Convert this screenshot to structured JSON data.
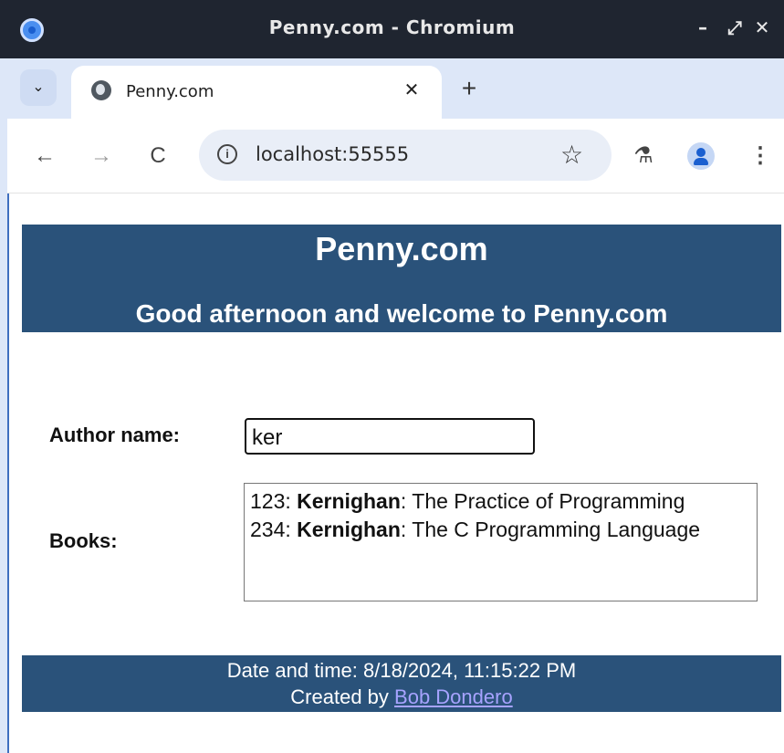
{
  "window": {
    "title": "Penny.com - Chromium",
    "minimize_glyph": "–",
    "maximize_glyph": "⤢",
    "close_glyph": "✕"
  },
  "tabs": {
    "dropdown_glyph": "⌄",
    "active": {
      "title": "Penny.com",
      "close_glyph": "✕"
    },
    "new_tab_glyph": "+"
  },
  "toolbar": {
    "back_glyph": "←",
    "forward_glyph": "→",
    "reload_glyph": "C",
    "info_glyph": "i",
    "url": "localhost:55555",
    "star_glyph": "☆",
    "labs_glyph": "⚗",
    "menu_glyph": "⋮"
  },
  "page": {
    "header": {
      "title": "Penny.com",
      "greeting": "Good afternoon and welcome to Penny.com"
    },
    "form": {
      "author_label": "Author name:",
      "author_value": "ker",
      "books_label": "Books:"
    },
    "books": [
      {
        "isbn": "123",
        "author": "Kernighan",
        "title": "The Practice of Programming"
      },
      {
        "isbn": "234",
        "author": "Kernighan",
        "title": "The C Programming Language"
      }
    ],
    "footer": {
      "datetime_label": "Date and time: 8/18/2024, 11:15:22 PM",
      "created_by": "Created by ",
      "author_link": "Bob Dondero"
    }
  },
  "colors": {
    "header_bg": "#2a527a",
    "titlebar_bg": "#1f2530",
    "tabstrip_bg": "#dde7f8",
    "link": "#a7a3ff"
  }
}
